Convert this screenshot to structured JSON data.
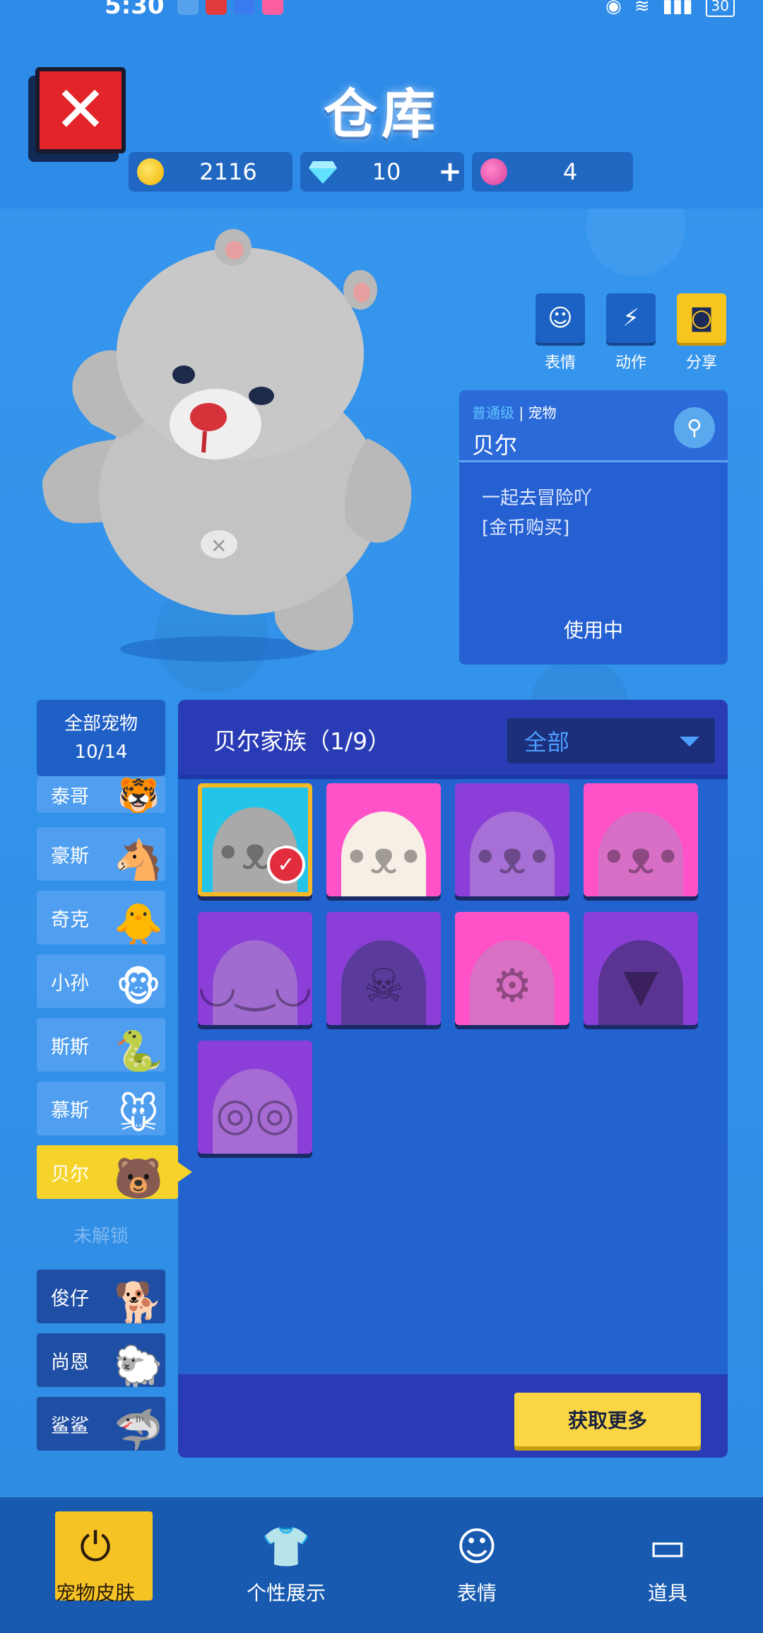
{
  "status": {
    "time": "5:30",
    "battery": "30"
  },
  "title": "仓库",
  "currencies": [
    {
      "name": "coin",
      "icon": "coin-icon",
      "value": "2116"
    },
    {
      "name": "diamond",
      "icon": "diamond-icon",
      "value": "10",
      "has_add": true
    },
    {
      "name": "gem",
      "icon": "gem-icon",
      "value": "4"
    }
  ],
  "actions": [
    {
      "label": "表情",
      "icon": "emote-icon"
    },
    {
      "label": "动作",
      "icon": "action-icon"
    },
    {
      "label": "分享",
      "icon": "camera-icon"
    }
  ],
  "pet_info": {
    "rank": "普通级",
    "kind": "宠物",
    "name": "贝尔",
    "desc_line1": "一起去冒险吖",
    "desc_line2": "[金币购买]",
    "status": "使用中"
  },
  "pet_list": {
    "all_label": "全部宠物",
    "all_count": "10/14",
    "unlocked": [
      "泰哥",
      "豪斯",
      "奇克",
      "小孙",
      "斯斯",
      "慕斯",
      "贝尔"
    ],
    "active": "贝尔",
    "unlock_header": "未解锁",
    "locked": [
      "俊仔",
      "尚恩",
      "鲨鲨"
    ]
  },
  "skin_panel": {
    "title": "贝尔家族（1/9）",
    "filter": "全部",
    "more_button": "获取更多"
  },
  "bottom_nav": [
    {
      "label": "宠物皮肤",
      "icon": "pet-skin-icon",
      "active": true
    },
    {
      "label": "个性展示",
      "icon": "shirt-icon",
      "active": false
    },
    {
      "label": "表情",
      "icon": "emote-icon",
      "active": false
    },
    {
      "label": "道具",
      "icon": "card-icon",
      "active": false
    }
  ]
}
